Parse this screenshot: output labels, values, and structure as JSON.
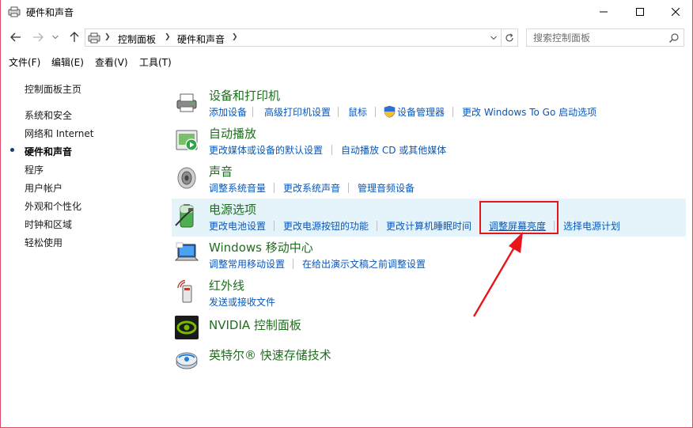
{
  "window": {
    "title": "硬件和声音"
  },
  "address": {
    "crumbs": [
      "控制面板",
      "硬件和声音"
    ],
    "search_placeholder": "搜索控制面板"
  },
  "menu": [
    "文件(F)",
    "编辑(E)",
    "查看(V)",
    "工具(T)"
  ],
  "sidebar": {
    "items": [
      {
        "label": "控制面板主页"
      },
      {
        "label": "系统和安全"
      },
      {
        "label": "网络和 Internet"
      },
      {
        "label": "硬件和声音",
        "current": true
      },
      {
        "label": "程序"
      },
      {
        "label": "用户帐户"
      },
      {
        "label": "外观和个性化"
      },
      {
        "label": "时钟和区域"
      },
      {
        "label": "轻松使用"
      }
    ]
  },
  "categories": [
    {
      "title": "设备和打印机",
      "icon": "printer-icon",
      "links": [
        "添加设备",
        "高级打印机设置",
        "鼠标",
        "设备管理器",
        "更改 Windows To Go 启动选项"
      ]
    },
    {
      "title": "自动播放",
      "icon": "autoplay-icon",
      "links": [
        "更改媒体或设备的默认设置",
        "自动播放 CD 或其他媒体"
      ]
    },
    {
      "title": "声音",
      "icon": "speaker-icon",
      "links": [
        "调整系统音量",
        "更改系统声音",
        "管理音频设备"
      ]
    },
    {
      "title": "电源选项",
      "icon": "battery-icon",
      "highlighted": true,
      "links": [
        "更改电池设置",
        "更改电源按钮的功能",
        "更改计算机睡眠时间",
        "调整屏幕亮度",
        "选择电源计划"
      ]
    },
    {
      "title": "Windows 移动中心",
      "icon": "laptop-icon",
      "links": [
        "调整常用移动设置",
        "在给出演示文稿之前调整设置"
      ]
    },
    {
      "title": "红外线",
      "icon": "infrared-icon",
      "links": [
        "发送或接收文件"
      ]
    },
    {
      "title": "NVIDIA 控制面板",
      "icon": "nvidia-icon",
      "links": []
    },
    {
      "title": "英特尔® 快速存储技术",
      "icon": "intel-storage-icon",
      "links": []
    }
  ],
  "colors": {
    "category_title": "#1e6e1e",
    "link": "#0b57b7",
    "highlight_bg": "#e5f3fb",
    "annotation_red": "#e8151b"
  }
}
